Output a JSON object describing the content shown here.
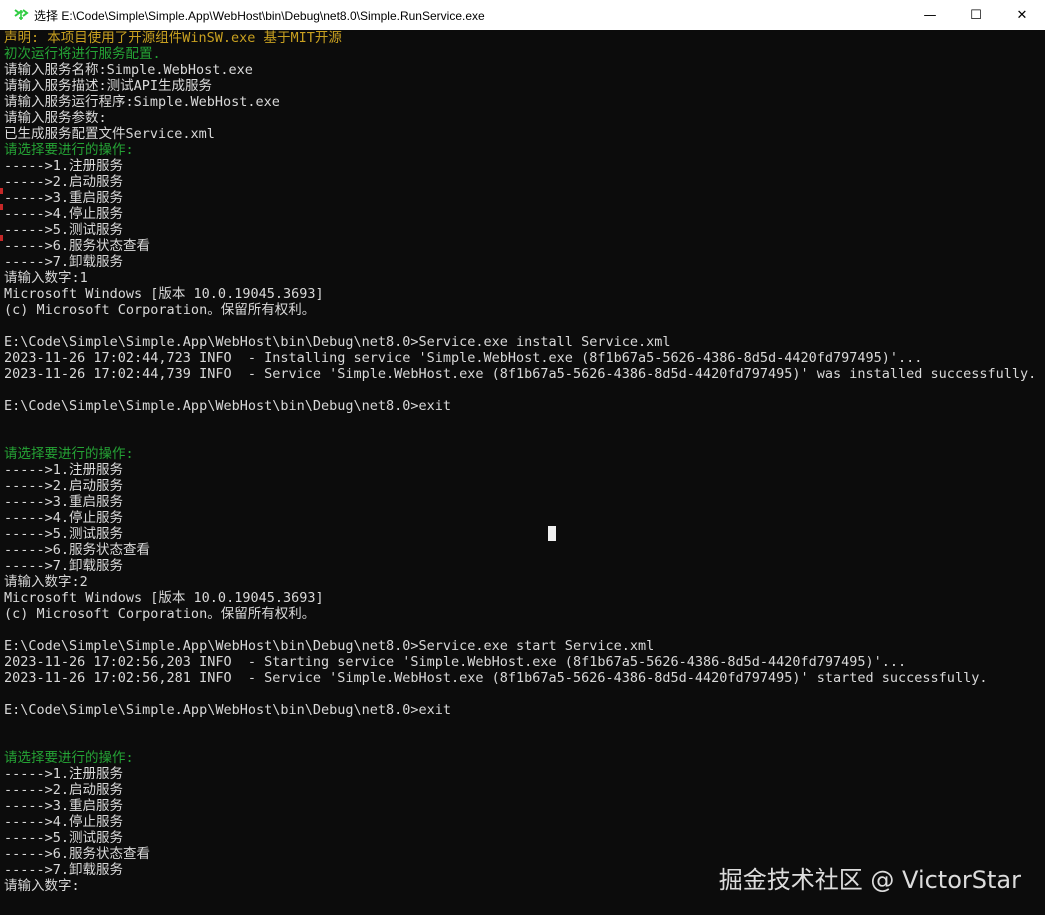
{
  "window": {
    "title": "选择 E:\\Code\\Simple\\Simple.App\\WebHost\\bin\\Debug\\net8.0\\Simple.RunService.exe",
    "icon": "console-app-icon",
    "accent_color": "#2ecc40",
    "minimize_glyph": "—",
    "maximize_glyph": "☐",
    "close_glyph": "✕"
  },
  "console": {
    "lines": [
      {
        "text": "声明: 本项目使用了开源组件WinSW.exe 基于MIT开源",
        "color": "yellow"
      },
      {
        "text": "初次运行将进行服务配置.",
        "color": "green"
      },
      {
        "text": "请输入服务名称:Simple.WebHost.exe",
        "color": "default"
      },
      {
        "text": "请输入服务描述:测试API生成服务",
        "color": "default"
      },
      {
        "text": "请输入服务运行程序:Simple.WebHost.exe",
        "color": "default"
      },
      {
        "text": "请输入服务参数:",
        "color": "default"
      },
      {
        "text": "已生成服务配置文件Service.xml",
        "color": "default"
      },
      {
        "text": "请选择要进行的操作:",
        "color": "green"
      },
      {
        "text": "----->1.注册服务",
        "color": "default"
      },
      {
        "text": "----->2.启动服务",
        "color": "default"
      },
      {
        "text": "----->3.重启服务",
        "color": "default"
      },
      {
        "text": "----->4.停止服务",
        "color": "default"
      },
      {
        "text": "----->5.测试服务",
        "color": "default"
      },
      {
        "text": "----->6.服务状态查看",
        "color": "default"
      },
      {
        "text": "----->7.卸载服务",
        "color": "default"
      },
      {
        "text": "请输入数字:1",
        "color": "default"
      },
      {
        "text": "Microsoft Windows [版本 10.0.19045.3693]",
        "color": "default"
      },
      {
        "text": "(c) Microsoft Corporation。保留所有权利。",
        "color": "default"
      },
      {
        "text": "",
        "color": "default"
      },
      {
        "text": "E:\\Code\\Simple\\Simple.App\\WebHost\\bin\\Debug\\net8.0>Service.exe install Service.xml",
        "color": "default"
      },
      {
        "text": "2023-11-26 17:02:44,723 INFO  - Installing service 'Simple.WebHost.exe (8f1b67a5-5626-4386-8d5d-4420fd797495)'...",
        "color": "default"
      },
      {
        "text": "2023-11-26 17:02:44,739 INFO  - Service 'Simple.WebHost.exe (8f1b67a5-5626-4386-8d5d-4420fd797495)' was installed successfully.",
        "color": "default"
      },
      {
        "text": "",
        "color": "default"
      },
      {
        "text": "E:\\Code\\Simple\\Simple.App\\WebHost\\bin\\Debug\\net8.0>exit",
        "color": "default"
      },
      {
        "text": "",
        "color": "default"
      },
      {
        "text": "",
        "color": "default"
      },
      {
        "text": "请选择要进行的操作:",
        "color": "green"
      },
      {
        "text": "----->1.注册服务",
        "color": "default"
      },
      {
        "text": "----->2.启动服务",
        "color": "default"
      },
      {
        "text": "----->3.重启服务",
        "color": "default"
      },
      {
        "text": "----->4.停止服务",
        "color": "default"
      },
      {
        "text": "----->5.测试服务",
        "color": "default"
      },
      {
        "text": "----->6.服务状态查看",
        "color": "default"
      },
      {
        "text": "----->7.卸载服务",
        "color": "default"
      },
      {
        "text": "请输入数字:2",
        "color": "default"
      },
      {
        "text": "Microsoft Windows [版本 10.0.19045.3693]",
        "color": "default"
      },
      {
        "text": "(c) Microsoft Corporation。保留所有权利。",
        "color": "default"
      },
      {
        "text": "",
        "color": "default"
      },
      {
        "text": "E:\\Code\\Simple\\Simple.App\\WebHost\\bin\\Debug\\net8.0>Service.exe start Service.xml",
        "color": "default"
      },
      {
        "text": "2023-11-26 17:02:56,203 INFO  - Starting service 'Simple.WebHost.exe (8f1b67a5-5626-4386-8d5d-4420fd797495)'...",
        "color": "default"
      },
      {
        "text": "2023-11-26 17:02:56,281 INFO  - Service 'Simple.WebHost.exe (8f1b67a5-5626-4386-8d5d-4420fd797495)' started successfully.",
        "color": "default"
      },
      {
        "text": "",
        "color": "default"
      },
      {
        "text": "E:\\Code\\Simple\\Simple.App\\WebHost\\bin\\Debug\\net8.0>exit",
        "color": "default"
      },
      {
        "text": "",
        "color": "default"
      },
      {
        "text": "",
        "color": "default"
      },
      {
        "text": "请选择要进行的操作:",
        "color": "green"
      },
      {
        "text": "----->1.注册服务",
        "color": "default"
      },
      {
        "text": "----->2.启动服务",
        "color": "default"
      },
      {
        "text": "----->3.重启服务",
        "color": "default"
      },
      {
        "text": "----->4.停止服务",
        "color": "default"
      },
      {
        "text": "----->5.测试服务",
        "color": "default"
      },
      {
        "text": "----->6.服务状态查看",
        "color": "default"
      },
      {
        "text": "----->7.卸载服务",
        "color": "default"
      },
      {
        "text": "请输入数字:",
        "color": "default"
      }
    ]
  },
  "watermark": "掘金技术社区 @ VictorStar"
}
